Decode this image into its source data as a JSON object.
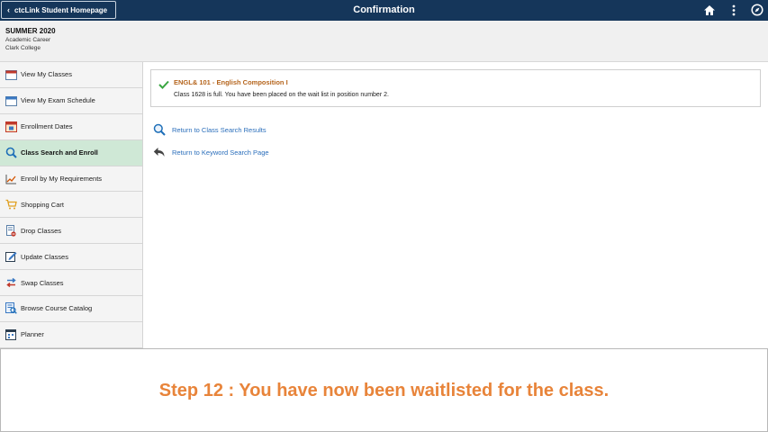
{
  "header": {
    "back_label": "ctcLink Student Homepage",
    "title": "Confirmation",
    "icons": [
      "home-icon",
      "more-vertical-icon",
      "navigator-icon"
    ]
  },
  "career": {
    "term": "SUMMER 2020",
    "career": "Academic Career",
    "institution": "Clark College"
  },
  "sidebar": {
    "items": [
      {
        "label": "View My Classes",
        "icon": "calendar-icon"
      },
      {
        "label": "View My Exam Schedule",
        "icon": "exam-calendar-icon"
      },
      {
        "label": "Enrollment Dates",
        "icon": "calendar-date-icon"
      },
      {
        "label": "Class Search and Enroll",
        "icon": "search-icon",
        "active": true
      },
      {
        "label": "Enroll by My Requirements",
        "icon": "chart-icon"
      },
      {
        "label": "Shopping Cart",
        "icon": "cart-icon"
      },
      {
        "label": "Drop Classes",
        "icon": "drop-icon"
      },
      {
        "label": "Update Classes",
        "icon": "edit-icon"
      },
      {
        "label": "Swap Classes",
        "icon": "swap-icon"
      },
      {
        "label": "Browse Course Catalog",
        "icon": "catalog-icon"
      },
      {
        "label": "Planner",
        "icon": "planner-icon"
      }
    ]
  },
  "message": {
    "title": "ENGL&  101 - English Composition I",
    "text": "Class 1628 is full. You have been placed on the wait list in position number 2."
  },
  "links": {
    "return_search": "Return to Class Search Results",
    "return_keyword": "Return to Keyword Search Page"
  },
  "caption": {
    "text": "Step 12 :  You have now been waitlisted for the class."
  },
  "colors": {
    "header_bg": "#15365a",
    "active_item": "#cfe8d6",
    "message_title": "#b5651d",
    "link": "#2a6ebb",
    "caption": "#e8843a"
  }
}
